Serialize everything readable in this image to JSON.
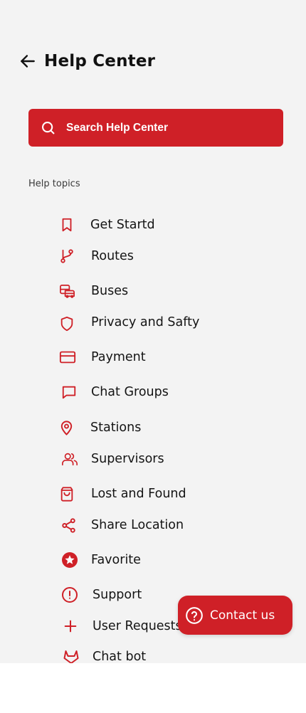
{
  "header": {
    "back_icon": "arrow-left-icon",
    "title": "Help Center"
  },
  "search": {
    "icon": "search-icon",
    "placeholder": "Search Help Center"
  },
  "section": {
    "label": "Help topics"
  },
  "topics": [
    {
      "label": "Get Startd",
      "icon": "bookmark-icon"
    },
    {
      "label": "Routes",
      "icon": "route-icon"
    },
    {
      "label": "Buses",
      "icon": "bus-icon"
    },
    {
      "label": "Privacy and Safty",
      "icon": "shield-icon"
    },
    {
      "label": "Payment",
      "icon": "credit-card-icon"
    },
    {
      "label": "Chat Groups",
      "icon": "chat-icon"
    },
    {
      "label": "Stations",
      "icon": "map-pin-icon"
    },
    {
      "label": "Supervisors",
      "icon": "users-icon"
    },
    {
      "label": "Lost and Found",
      "icon": "shopping-bag-icon"
    },
    {
      "label": "Share Location",
      "icon": "share-icon"
    },
    {
      "label": "Favorite",
      "icon": "star-circle-icon"
    },
    {
      "label": "Support",
      "icon": "alert-circle-icon"
    },
    {
      "label": "User Requests",
      "icon": "plus-icon"
    },
    {
      "label": "Chat bot",
      "icon": "gitlab-icon"
    }
  ],
  "contact": {
    "icon": "help-circle-icon",
    "label": "Contact us"
  },
  "colors": {
    "accent": "#cf2027",
    "background": "#f3f3f3",
    "text": "#141414"
  }
}
